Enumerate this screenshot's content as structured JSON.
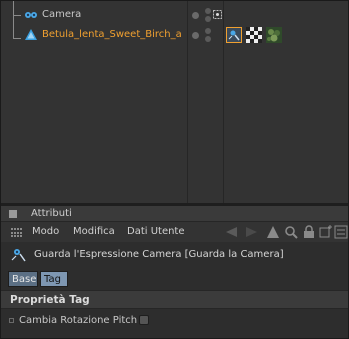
{
  "object_manager": {
    "objects": [
      {
        "name": "Camera",
        "icon": "camera-icon",
        "color": "#c8c8c8"
      },
      {
        "name": "Betula_lenta_Sweet_Birch_a",
        "icon": "tree-object-icon",
        "color": "#f0a030"
      }
    ],
    "tags": [
      "look-at-camera-tag-icon",
      "checker-material-tag-icon",
      "texture-material-tag-icon"
    ]
  },
  "attributes": {
    "title": "Attributi",
    "menu": [
      "Modo",
      "Modifica",
      "Dati Utente"
    ],
    "toolbar_icons": [
      "back-arrow-icon",
      "forward-arrow-icon",
      "up-arrow-icon",
      "search-icon",
      "lock-icon",
      "new-window-icon",
      "options-icon"
    ],
    "object_title": "Guarda l'Espressione Camera [Guarda la Camera]",
    "tabs": [
      {
        "label": "Base",
        "active": false
      },
      {
        "label": "Tag",
        "active": true
      }
    ],
    "section_title": "Proprietà Tag",
    "params": [
      {
        "label": "Cambia Rotazione Pitch",
        "checked": false
      }
    ]
  },
  "colors": {
    "accent_object": "#f0a030",
    "tab_active": "#7e97b2",
    "panel_bg": "#333333"
  }
}
